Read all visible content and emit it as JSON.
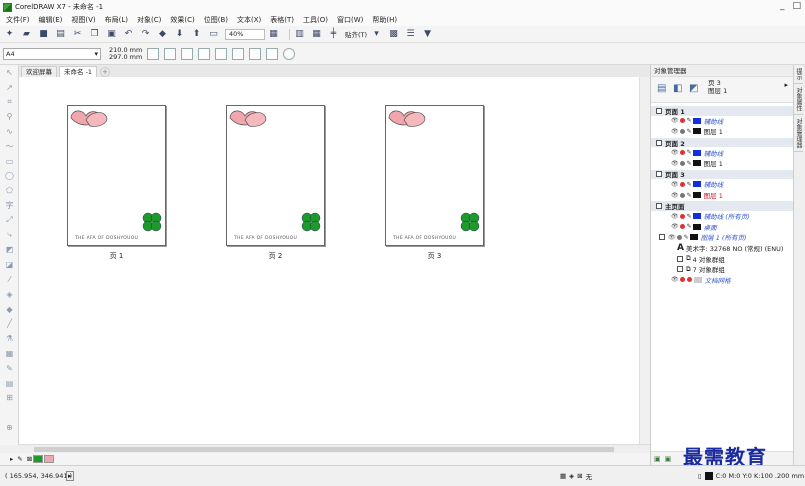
{
  "window": {
    "title": "CorelDRAW X7 - 未命名 -1",
    "controls": [
      "_",
      "□"
    ]
  },
  "menu": [
    "文件(F)",
    "编辑(E)",
    "视图(V)",
    "布局(L)",
    "对象(C)",
    "效果(C)",
    "位图(B)",
    "文本(X)",
    "表格(T)",
    "工具(O)",
    "窗口(W)",
    "帮助(H)"
  ],
  "toolbar": {
    "zoom": "40%",
    "snap_label": "贴齐(T)"
  },
  "property_bar": {
    "paper": "A4",
    "width": "210.0 mm",
    "height": "297.0 mm"
  },
  "tabs": [
    {
      "label": "欢迎屏幕",
      "active": false
    },
    {
      "label": "未命名 -1",
      "active": true
    }
  ],
  "pages": [
    {
      "caption": "页 1",
      "footer": "THE AFA OF DOSHYOUOU"
    },
    {
      "caption": "页 2",
      "footer": "THE AFA OF DOSHYOUOU"
    },
    {
      "caption": "页 3",
      "footer": "THE AFA OF DOSHYOUOU"
    }
  ],
  "object_manager": {
    "title": "对象管理器",
    "current_page": "页 3",
    "current_layer": "图层 1",
    "pages": [
      {
        "name": "页面 1",
        "layers": [
          {
            "name": "辅助线",
            "style": "blue",
            "color": "#1030e0"
          },
          {
            "name": "图层 1",
            "style": "normal",
            "color": "#111111"
          }
        ]
      },
      {
        "name": "页面 2",
        "layers": [
          {
            "name": "辅助线",
            "style": "blue",
            "color": "#1030e0"
          },
          {
            "name": "图层 1",
            "style": "normal",
            "color": "#111111"
          }
        ]
      },
      {
        "name": "页面 3",
        "layers": [
          {
            "name": "辅助线",
            "style": "blue",
            "color": "#1030e0"
          },
          {
            "name": "图层 1",
            "style": "red",
            "color": "#111111"
          }
        ]
      }
    ],
    "master": {
      "name": "主页面",
      "layers": [
        {
          "name": "辅助线 (所有页)",
          "style": "blue",
          "color": "#1030e0"
        },
        {
          "name": "桌面",
          "style": "blue",
          "color": "#111111"
        },
        {
          "name": "图层 1 (所有页)",
          "style": "blue",
          "color": "#111111"
        }
      ],
      "objects": [
        "美术字: 32768 NO (常规) (ENU)",
        "4 对象群组",
        "7 对象群组"
      ],
      "extra": "文档网格"
    }
  },
  "side_tabs": [
    "提示",
    "对象属性",
    "对象管理器"
  ],
  "status": {
    "coords": "( 165.954, 346.941 )",
    "fill": "无",
    "color": "C:0 M:0 Y:0 K:100 .200 mm"
  },
  "watermark": "最需教育"
}
